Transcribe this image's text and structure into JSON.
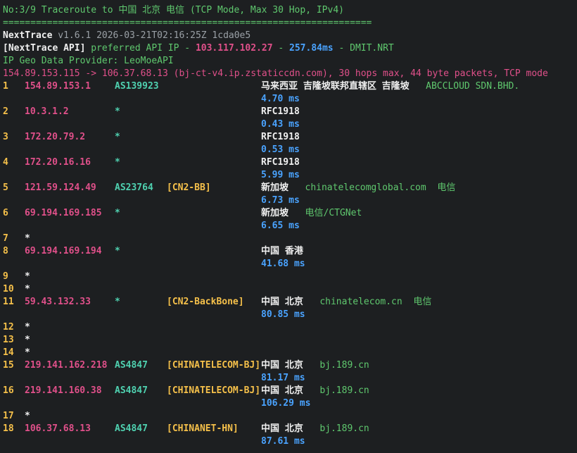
{
  "header": {
    "title": "No:3/9 Traceroute to 中国 北京 电信 (TCP Mode, Max 30 Hop, IPv4)",
    "separator": "===================================================================",
    "version_name": "NextTrace",
    "version_rest": " v1.6.1 2026-03-21T02:16:25Z 1cda0e5",
    "api_label": "[NextTrace API]",
    "api_pref": " preferred API IP - ",
    "api_ip": "103.117.102.27",
    "api_dash": " - ",
    "api_latency": "257.84ms",
    "api_node": " - DMIT.NRT",
    "geo_provider": "IP Geo Data Provider: LeoMoeAPI",
    "summary": "154.89.153.115 -> 106.37.68.13 (bj-ct-v4.ip.zstaticcdn.com), 30 hops max, 44 byte packets, TCP mode"
  },
  "hops": [
    {
      "num": "1",
      "ip": "154.89.153.1",
      "as": "AS139923",
      "tag": "",
      "geo": "马来西亚 吉隆坡联邦直辖区 吉隆坡",
      "org": "ABCCLOUD SDN.BHD.",
      "rtt": "4.70 ms"
    },
    {
      "num": "2",
      "ip": "10.3.1.2",
      "as": "*",
      "tag": "",
      "geo": "RFC1918",
      "org": "",
      "rtt": "0.43 ms"
    },
    {
      "num": "3",
      "ip": "172.20.79.2",
      "as": "*",
      "tag": "",
      "geo": "RFC1918",
      "org": "",
      "rtt": "0.53 ms"
    },
    {
      "num": "4",
      "ip": "172.20.16.16",
      "as": "*",
      "tag": "",
      "geo": "RFC1918",
      "org": "",
      "rtt": "5.99 ms"
    },
    {
      "num": "5",
      "ip": "121.59.124.49",
      "as": "AS23764",
      "tag": "[CN2-BB]",
      "geo": "新加坡",
      "org": "chinatelecomglobal.com  电信",
      "rtt": "6.73 ms"
    },
    {
      "num": "6",
      "ip": "69.194.169.185",
      "as": "*",
      "tag": "",
      "geo": "新加坡",
      "org": "电信/CTGNet",
      "rtt": "6.65 ms"
    },
    {
      "num": "7",
      "star": "*"
    },
    {
      "num": "8",
      "ip": "69.194.169.194",
      "as": "*",
      "tag": "",
      "geo": "中国 香港",
      "org": "",
      "rtt": "41.68 ms"
    },
    {
      "num": "9",
      "star": "*"
    },
    {
      "num": "10",
      "star": "*"
    },
    {
      "num": "11",
      "ip": "59.43.132.33",
      "as": "*",
      "tag": "[CN2-BackBone]",
      "geo": "中国 北京",
      "org": "chinatelecom.cn  电信",
      "rtt": "80.85 ms"
    },
    {
      "num": "12",
      "star": "*"
    },
    {
      "num": "13",
      "star": "*"
    },
    {
      "num": "14",
      "star": "*"
    },
    {
      "num": "15",
      "ip": "219.141.162.218",
      "as": "AS4847",
      "tag": "[CHINATELECOM-BJ]",
      "geo": "中国 北京",
      "org": "bj.189.cn",
      "rtt": "81.17 ms"
    },
    {
      "num": "16",
      "ip": "219.141.160.38",
      "as": "AS4847",
      "tag": "[CHINATELECOM-BJ]",
      "geo": "中国 北京",
      "org": "bj.189.cn",
      "rtt": "106.29 ms"
    },
    {
      "num": "17",
      "star": "*"
    },
    {
      "num": "18",
      "ip": "106.37.68.13",
      "as": "AS4847",
      "tag": "[CHINANET-HN]",
      "geo": "中国 北京",
      "org": "bj.189.cn",
      "rtt": "87.61 ms"
    }
  ]
}
